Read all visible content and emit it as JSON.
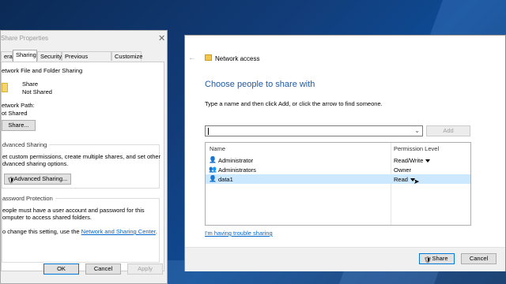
{
  "share_properties": {
    "title": "Share Properties",
    "close_icon": "close-icon",
    "tabs": [
      {
        "label": "eral"
      },
      {
        "label": "Sharing"
      },
      {
        "label": "Security"
      },
      {
        "label": "Previous Versions"
      },
      {
        "label": "Customize"
      }
    ],
    "network_sharing": {
      "heading": "etwork File and Folder Sharing",
      "item_name": "Share",
      "item_status": "Not Shared",
      "path_label": "etwork Path:",
      "path_value": "ot Shared",
      "share_button": "Share..."
    },
    "advanced_sharing": {
      "heading": "dvanced Sharing",
      "desc_line1": "et custom permissions, create multiple shares, and set other",
      "desc_line2": "dvanced sharing options.",
      "button": "Advanced Sharing..."
    },
    "password_protection": {
      "heading": "assword Protection",
      "desc_line1": "eople must have a user account and password for this",
      "desc_line2": "omputer to access shared folders.",
      "desc_line3": "o change this setting, use the",
      "link": "Network and Sharing Center",
      "trailing": "."
    },
    "buttons": {
      "ok": "OK",
      "cancel": "Cancel",
      "apply": "Apply"
    }
  },
  "network_access": {
    "back_icon": "back-arrow-icon",
    "title": "Network access",
    "heading": "Choose people to share with",
    "instruction": "Type a name and then click Add, or click the arrow to find someone.",
    "name_input": {
      "value": "",
      "placeholder": ""
    },
    "add_button": "Add",
    "columns": {
      "name": "Name",
      "permission": "Permission Level"
    },
    "rows": [
      {
        "name": "Administrator",
        "permission": "Read/Write",
        "selected": false
      },
      {
        "name": "Administrators",
        "permission": "Owner",
        "selected": false
      },
      {
        "name": "data1",
        "permission": "Read",
        "selected": true
      }
    ],
    "trouble_link": "I'm having trouble sharing",
    "share_button": "Share",
    "cancel_button": "Cancel"
  },
  "colors": {
    "accent": "#0078d7",
    "heading": "#1e5aa8",
    "selection": "#cce8ff",
    "link": "#0066cc"
  }
}
